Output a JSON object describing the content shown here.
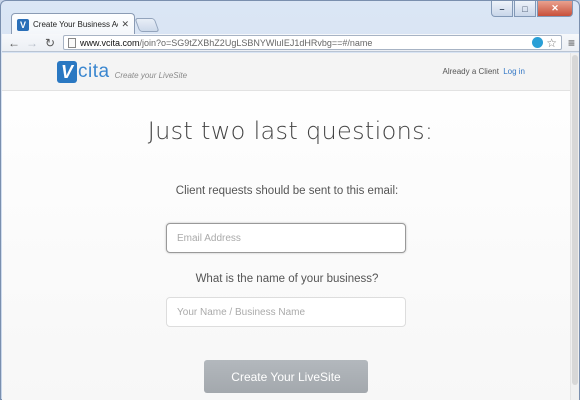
{
  "window": {
    "minimize": "–",
    "maximize": "□",
    "close": "✕"
  },
  "tab": {
    "favicon": "V",
    "title": "Create Your Business Acc",
    "close": "✕"
  },
  "toolbar": {
    "back": "←",
    "forward": "→",
    "reload": "↻",
    "url_host": "www.vcita.com",
    "url_path": "/join?o=SG9tZXBhZ2UgLSBNYWluIEJ1dHRvbg==#/name",
    "star": "☆",
    "menu": "≡"
  },
  "header": {
    "logo_mark": "V",
    "logo_text": "cita",
    "tagline": "Create your LiveSite",
    "already_text": "Already a Client",
    "login_link": "Log in"
  },
  "main": {
    "headline": "Just two last questions:",
    "q1_label": "Client requests should be sent to this email:",
    "email_placeholder": "Email Address",
    "q2_label": "What is the name of your business?",
    "name_placeholder": "Your Name / Business Name",
    "submit_label": "Create Your LiveSite"
  },
  "colors": {
    "brand": "#2a78c2",
    "link": "#3478c6",
    "button": "#aaafb4"
  }
}
